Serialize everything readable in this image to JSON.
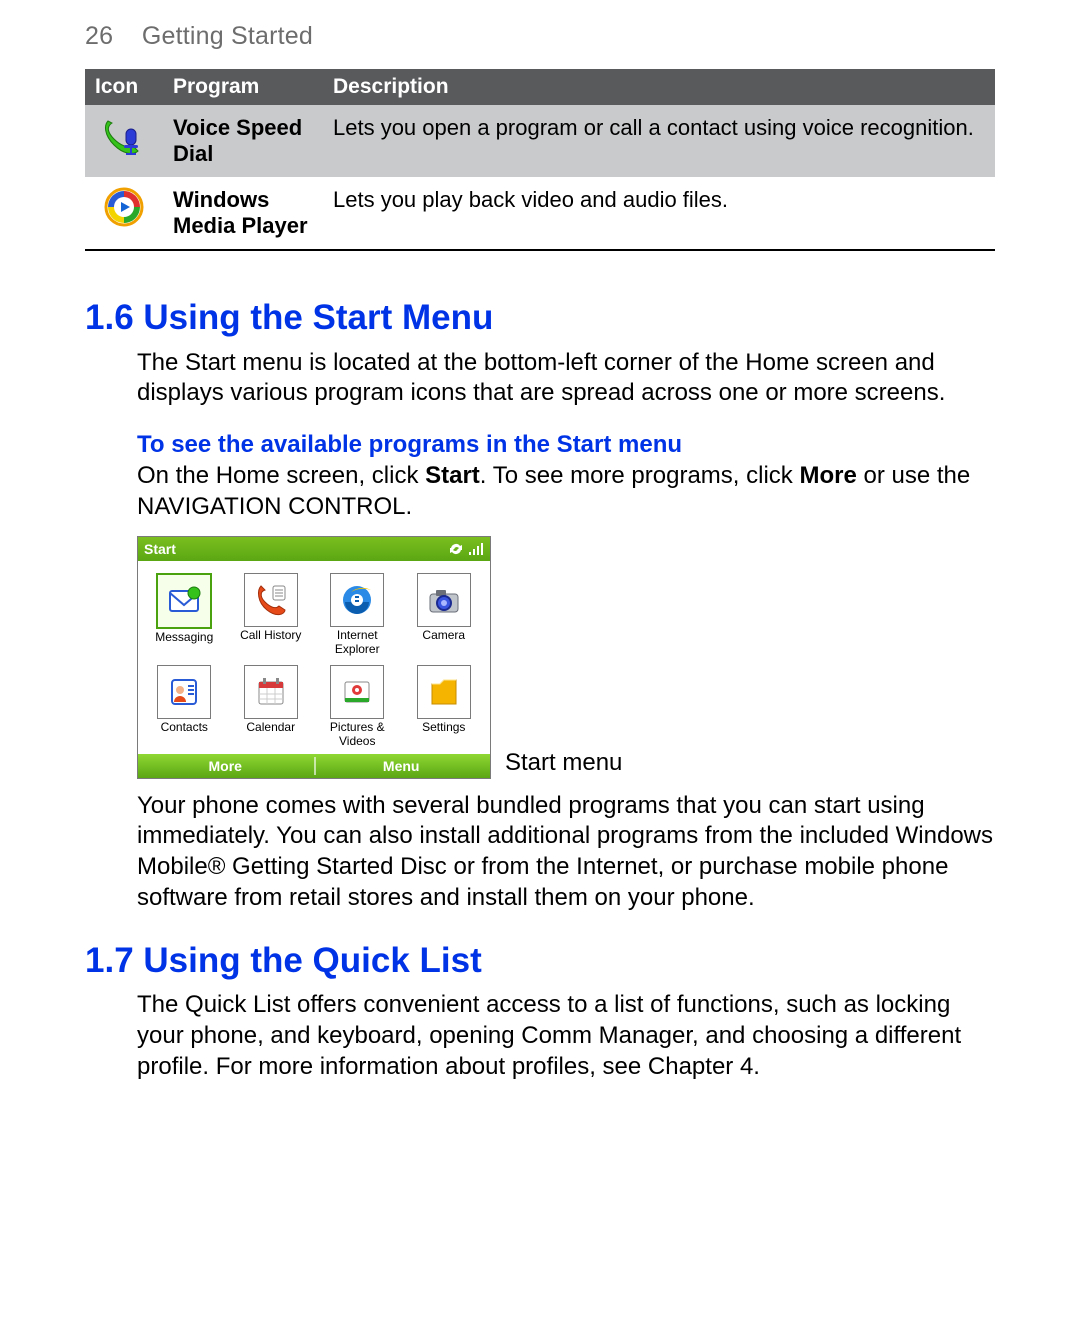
{
  "page": {
    "number": "26",
    "section_title": "Getting Started"
  },
  "table": {
    "headers": {
      "icon": "Icon",
      "program": "Program",
      "description": "Description"
    },
    "rows": [
      {
        "program": "Voice Speed Dial",
        "description": "Lets you open a program or call a contact using voice recognition.",
        "icon_name": "voice-speed-dial-icon"
      },
      {
        "program": "Windows Media Player",
        "description": "Lets you play back video and audio files.",
        "icon_name": "windows-media-player-icon"
      }
    ]
  },
  "section16": {
    "heading": "1.6 Using the Start Menu",
    "intro": "The Start menu is located at the bottom-left corner of the Home screen and displays various program icons that are spread across one or more screens.",
    "subhead": "To see the available programs in the Start menu",
    "para1_pre": "On the Home screen, click ",
    "para1_start": "Start",
    "para1_mid": ". To see more programs, click ",
    "para1_more": "More",
    "para1_post": " or use the NAVIGATION CONTROL.",
    "caption": "Start menu",
    "para2": "Your phone comes with several bundled programs that you can start using immediately. You can also install additional programs from the included Windows Mobile® Getting Started Disc or from the Internet, or purchase mobile phone software from retail stores and install them on your phone."
  },
  "start_menu": {
    "title": "Start",
    "status_icons": [
      "sync-icon",
      "signal-icon"
    ],
    "items": [
      {
        "label": "Messaging",
        "icon": "messaging-icon",
        "selected": true
      },
      {
        "label": "Call History",
        "icon": "call-history-icon"
      },
      {
        "label": "Internet\nExplorer",
        "icon": "ie-icon"
      },
      {
        "label": "Camera",
        "icon": "camera-icon"
      },
      {
        "label": "Contacts",
        "icon": "contacts-icon"
      },
      {
        "label": "Calendar",
        "icon": "calendar-icon"
      },
      {
        "label": "Pictures &\nVideos",
        "icon": "pictures-icon"
      },
      {
        "label": "Settings",
        "icon": "settings-icon"
      }
    ],
    "softkeys": {
      "left": "More",
      "right": "Menu"
    }
  },
  "section17": {
    "heading": "1.7 Using the Quick List",
    "intro": "The Quick List offers convenient access to a list of functions, such as locking your phone, and keyboard, opening Comm Manager, and choosing a different profile. For more information about profiles, see Chapter 4."
  }
}
